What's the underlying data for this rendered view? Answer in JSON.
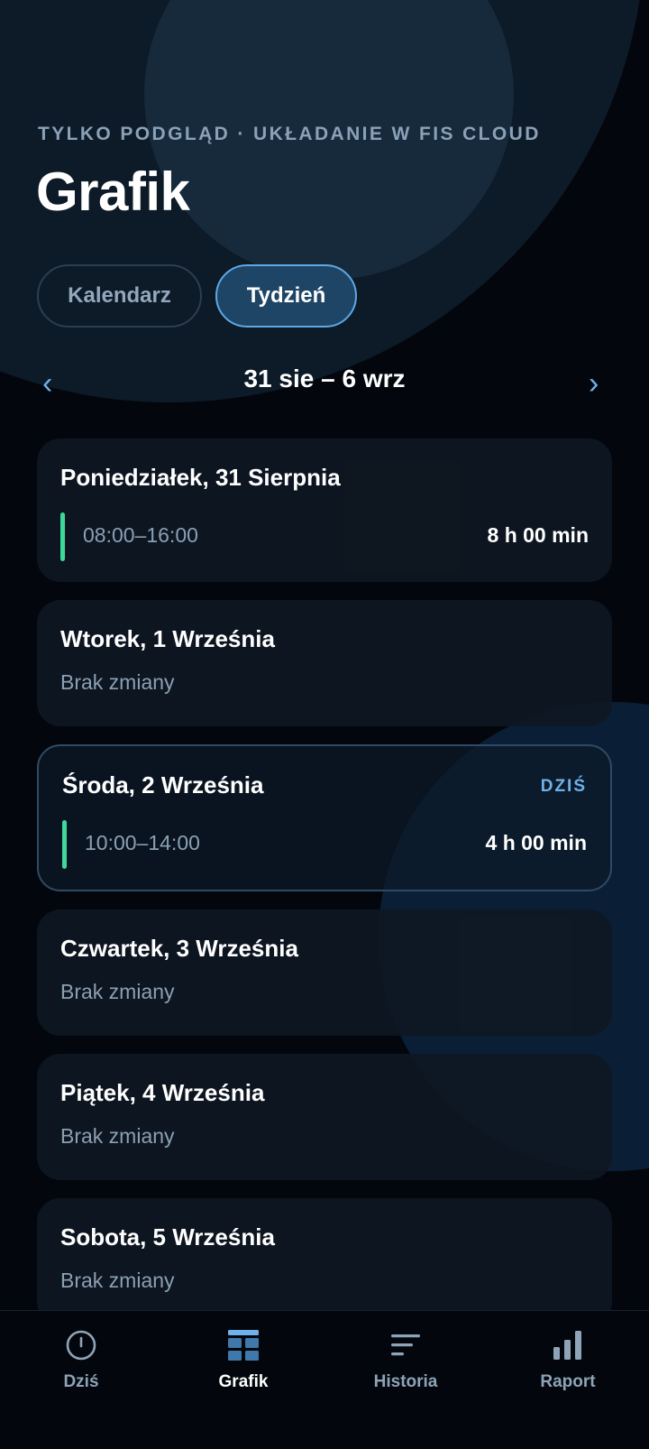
{
  "header": {
    "eyebrow": "TYLKO PODGLĄD · UKŁADANIE W FIS CLOUD",
    "title": "Grafik"
  },
  "view_toggle": {
    "calendar_label": "Kalendarz",
    "week_label": "Tydzień",
    "selected": "Tydzień"
  },
  "week_nav": {
    "prev_glyph": "‹",
    "next_glyph": "›",
    "range": "31 sie – 6 wrz"
  },
  "days": [
    {
      "name": "Poniedziałek, 31 Sierpnia",
      "time": "08:00–16:00",
      "duration": "8 h 00 min"
    },
    {
      "name": "Wtorek, 1 Września",
      "status": "Brak zmiany"
    },
    {
      "name": "Środa, 2 Września",
      "badge": "DZIŚ",
      "time": "10:00–14:00",
      "duration": "4 h 00 min"
    },
    {
      "name": "Czwartek, 3 Września",
      "status": "Brak zmiany"
    },
    {
      "name": "Piątek, 4 Września",
      "status": "Brak zmiany"
    },
    {
      "name": "Sobota, 5 Września",
      "status": "Brak zmiany"
    }
  ],
  "bottom_nav": {
    "items": [
      {
        "label": "Dziś",
        "icon": "clock-icon"
      },
      {
        "label": "Grafik",
        "icon": "schedule-grid-icon"
      },
      {
        "label": "Historia",
        "icon": "history-lines-icon"
      },
      {
        "label": "Raport",
        "icon": "bar-chart-icon"
      }
    ],
    "active": "Grafik"
  },
  "colors": {
    "background": "#03070d",
    "card": "#0f1823",
    "accent_blue": "#6fb1ea",
    "shift_green": "#3ed89a",
    "muted_text": "#8aa0b4"
  }
}
